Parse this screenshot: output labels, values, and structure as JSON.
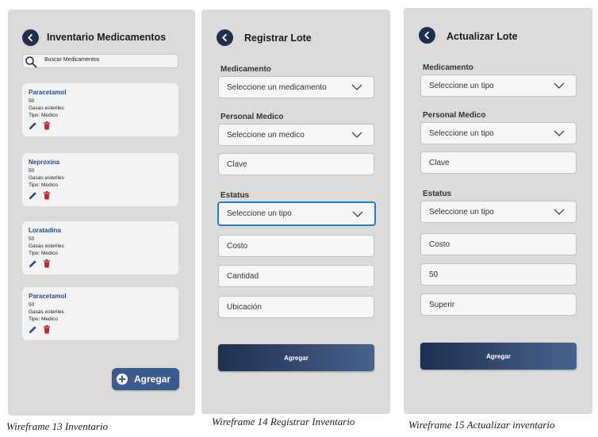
{
  "inventario": {
    "title": "Inventario Medicamentos",
    "search_placeholder": "Buscar Medicamentos",
    "items": [
      {
        "name": "Paracetamol",
        "qty": "50",
        "desc": "Gasas esteriles",
        "type": "Tipo: Medico"
      },
      {
        "name": "Neproxina",
        "qty": "50",
        "desc": "Gasas esteriles",
        "type": "Tipo: Medico"
      },
      {
        "name": "Loratadina",
        "qty": "50",
        "desc": "Gasas esteriles",
        "type": "Tipo: Medico"
      },
      {
        "name": "Paracetamol",
        "qty": "50",
        "desc": "Gasas esteriles",
        "type": "Tipo: Medico"
      }
    ],
    "add_label": "Agregar",
    "caption": "Wireframe 13 Inventario"
  },
  "registrar": {
    "title": "Registrar Lote",
    "medicamento_label": "Medicamento",
    "medicamento_value": "Seleccione un  medicamento",
    "personal_label": "Personal Medico",
    "personal_value": "Seleccione un medico",
    "clave_placeholder": "Clave",
    "estatus_label": "Estatus",
    "estatus_value": "Seleccione un tipo",
    "costo_placeholder": "Costo",
    "cantidad_placeholder": "Cantidad",
    "ubicacion_placeholder": "Ubicación",
    "submit_label": "Agregar",
    "caption": "Wireframe 14 Registrar Inventario"
  },
  "actualizar": {
    "title": "Actualizar Lote",
    "medicamento_label": "Medicamento",
    "medicamento_value": "Seleccione un tipo",
    "personal_label": "Personal Medico",
    "personal_value": "Seleccione un tipo",
    "clave_value": "Clave",
    "estatus_label": "Estatus",
    "estatus_value": "Seleccione un tipo",
    "costo_value": "Costo",
    "cantidad_value": "50",
    "ubicacion_value": "Superir",
    "submit_label": "Agregar",
    "caption": "Wireframe 15 Actualizar inventario"
  },
  "colors": {
    "accent_dark": "#1f2f4d",
    "fab_blue": "#3b5b8e",
    "focus_blue": "#1b7fd6",
    "delete_red": "#c0262d",
    "item_title_blue": "#2a4a8c"
  },
  "icons": [
    "back-arrow-icon",
    "search-icon",
    "pencil-icon",
    "trash-icon",
    "plus-icon",
    "chevron-down-icon"
  ]
}
